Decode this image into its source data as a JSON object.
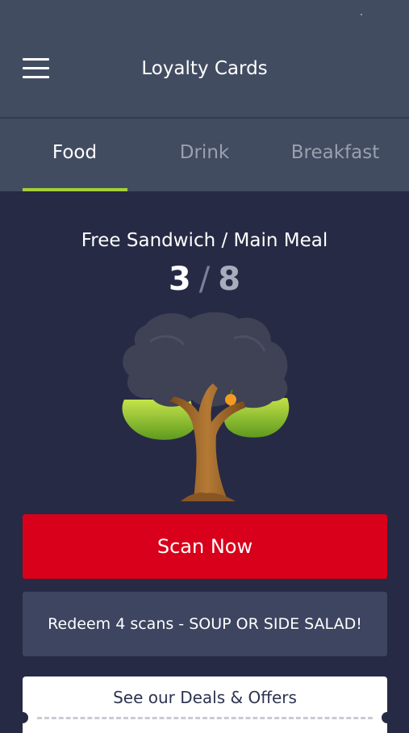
{
  "header": {
    "title": "Loyalty Cards"
  },
  "tabs": [
    {
      "label": "Food",
      "active": true
    },
    {
      "label": "Drink",
      "active": false
    },
    {
      "label": "Breakfast",
      "active": false
    }
  ],
  "card": {
    "title": "Free Sandwich / Main Meal",
    "current": "3",
    "separator": "/",
    "total": "8"
  },
  "buttons": {
    "scan_label": "Scan Now",
    "redeem_label": "Redeem 4 scans - SOUP OR SIDE SALAD!",
    "deals_label": "See our Deals & Offers"
  },
  "icons": {
    "menu": "hamburger-menu-icon",
    "tree": "loyalty-tree-illustration"
  },
  "colors": {
    "header_bg": "#424c61",
    "page_bg": "#272a44",
    "tab_indicator": "#a5cf3a",
    "scan_button": "#d8001a",
    "redeem_bg": "#3d4560"
  }
}
